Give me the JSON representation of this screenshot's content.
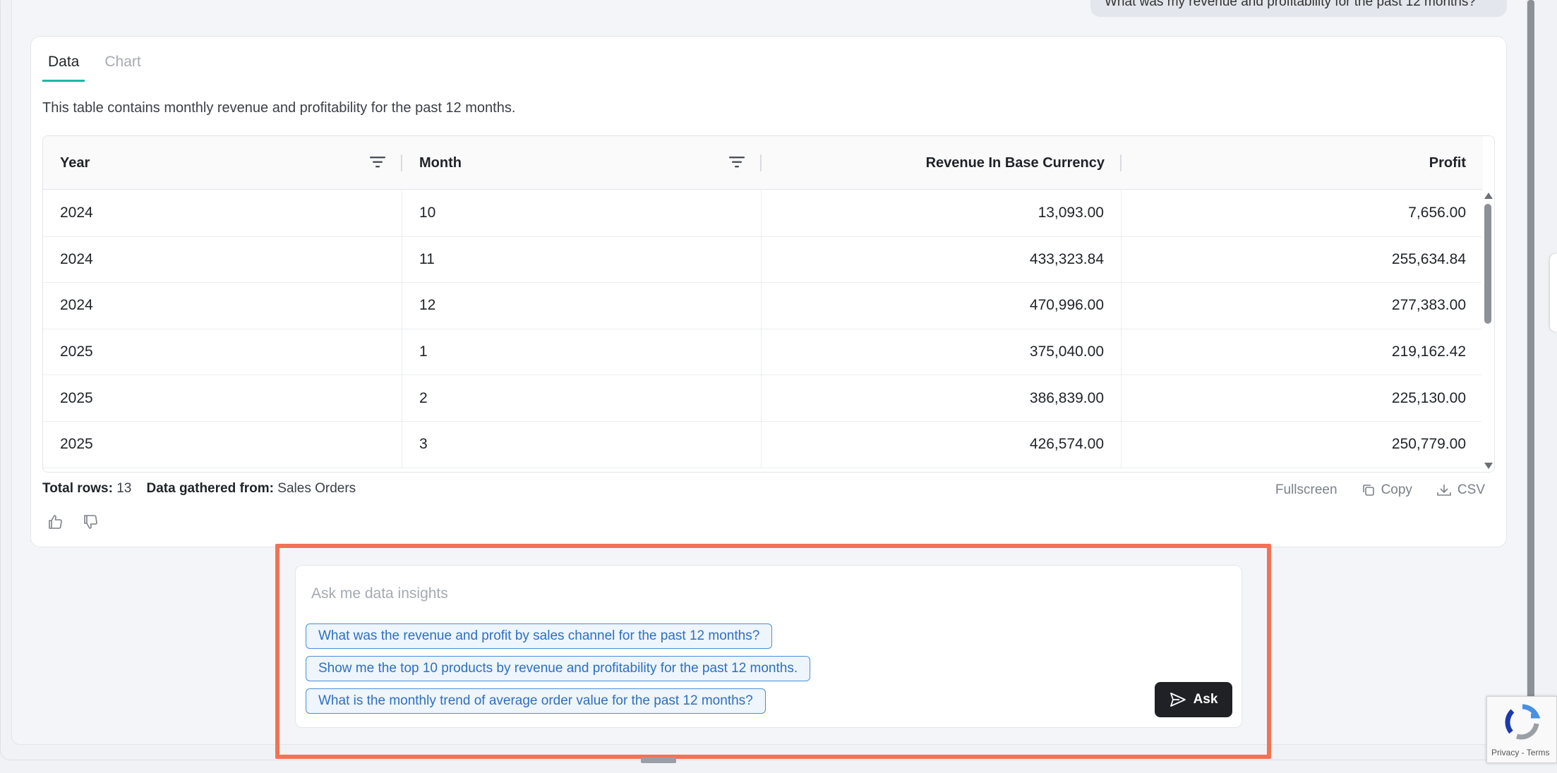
{
  "chat": {
    "user_message": "What was my revenue and profitability for the past 12 months?"
  },
  "result": {
    "tabs": [
      {
        "label": "Data",
        "active": true
      },
      {
        "label": "Chart",
        "active": false
      }
    ],
    "description": "This table contains monthly revenue and profitability for the past 12 months.",
    "table": {
      "columns": [
        "Year",
        "Month",
        "Revenue In Base Currency",
        "Profit"
      ],
      "rows": [
        [
          "2024",
          "10",
          "13,093.00",
          "7,656.00"
        ],
        [
          "2024",
          "11",
          "433,323.84",
          "255,634.84"
        ],
        [
          "2024",
          "12",
          "470,996.00",
          "277,383.00"
        ],
        [
          "2025",
          "1",
          "375,040.00",
          "219,162.42"
        ],
        [
          "2025",
          "2",
          "386,839.00",
          "225,130.00"
        ],
        [
          "2025",
          "3",
          "426,574.00",
          "250,779.00"
        ]
      ]
    },
    "footer": {
      "total_rows_label": "Total rows:",
      "total_rows_value": "13",
      "source_label": "Data gathered from:",
      "source_value": "Sales Orders",
      "fullscreen": "Fullscreen",
      "copy": "Copy",
      "csv": "CSV"
    }
  },
  "ask": {
    "placeholder": "Ask me data insights",
    "suggestions": [
      "What was the revenue and profit by sales channel for the past 12 months?",
      "Show me the top 10 products by revenue and profitability for the past 12 months.",
      "What is the monthly trend of average order value for the past 12 months?"
    ],
    "button_label": "Ask"
  },
  "recaptcha": {
    "privacy": "Privacy",
    "separator": " - ",
    "terms": "Terms"
  },
  "colors": {
    "accent_tab": "#22b5a8",
    "highlight_border": "#f27256",
    "chip_border": "#4a90d9",
    "ask_button": "#1f2124"
  }
}
